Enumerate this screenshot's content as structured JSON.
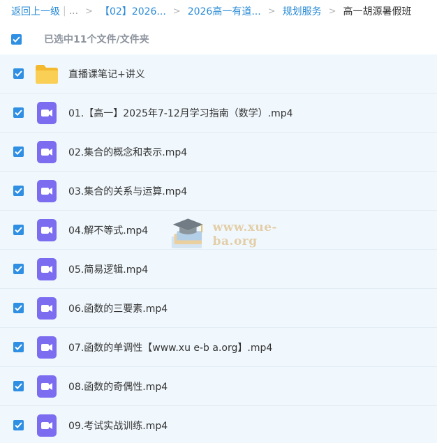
{
  "breadcrumb": {
    "back": "返回上一级",
    "sep": "|",
    "ellipsis": "...",
    "arrow": ">",
    "items": [
      "【02】2026...",
      "2026高一有道...",
      "规划服务"
    ],
    "current": "高一胡源暑假班"
  },
  "selection": {
    "text": "已选中11个文件/文件夹"
  },
  "files": [
    {
      "name": "直播课笔记+讲义",
      "icon": "folder-icon"
    },
    {
      "name": "01.【高一】2025年7-12月学习指南（数学）.mp4",
      "icon": "video-icon"
    },
    {
      "name": "02.集合的概念和表示.mp4",
      "icon": "video-icon"
    },
    {
      "name": "03.集合的关系与运算.mp4",
      "icon": "video-icon"
    },
    {
      "name": "04.解不等式.mp4",
      "icon": "video-icon"
    },
    {
      "name": "05.简易逻辑.mp4",
      "icon": "video-icon"
    },
    {
      "name": "06.函数的三要素.mp4",
      "icon": "video-icon"
    },
    {
      "name": "07.函数的单调性【www.xu e-b a.org】.mp4",
      "icon": "video-icon"
    },
    {
      "name": "08.函数的奇偶性.mp4",
      "icon": "video-icon"
    },
    {
      "name": "09.考试实战训练.mp4",
      "icon": "video-icon"
    }
  ],
  "watermark": {
    "text": "www.xue-ba.org"
  },
  "colors": {
    "accent": "#2f8fe3",
    "link": "#2a8bd6",
    "folder": "#f7c93d",
    "video": "#7b6cf0",
    "list_bg": "#f1f8fd"
  }
}
